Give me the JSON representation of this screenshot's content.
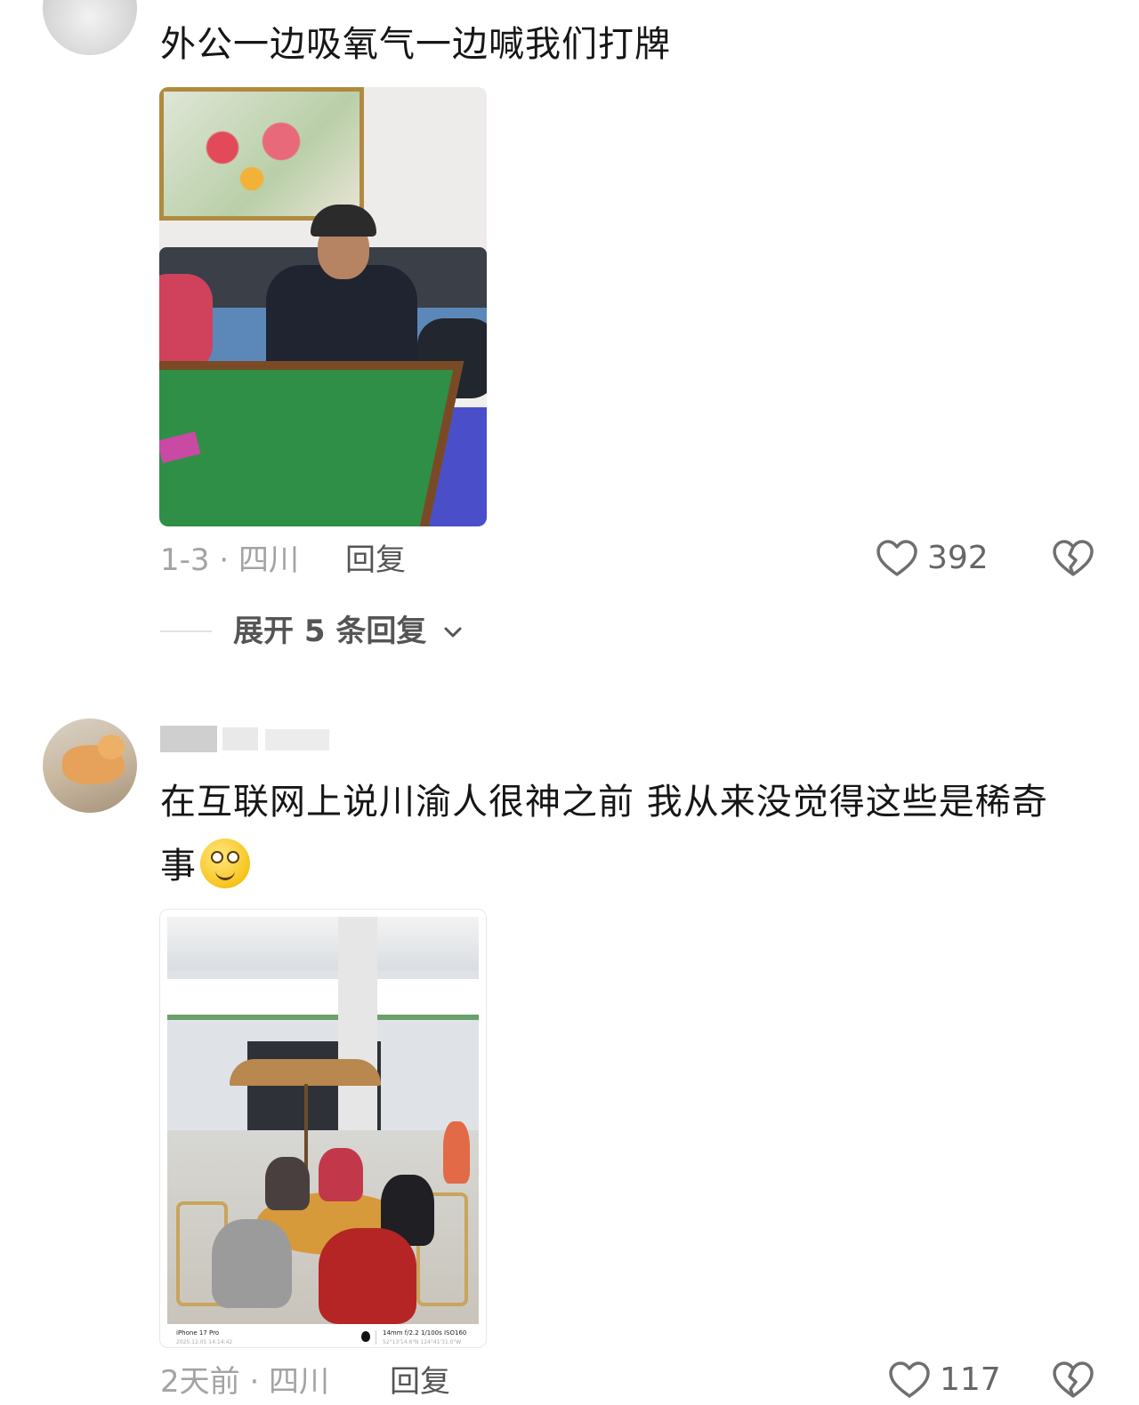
{
  "comments": [
    {
      "text": "外公一边吸氧气一边喊我们打牌",
      "meta": "1-3 · 四川",
      "reply_label": "回复",
      "likes": "392",
      "expand_label": "展开 5 条回复"
    },
    {
      "text": "在互联网上说川渝人很神之前 我从来没觉得这些是稀奇事",
      "meta": "2天前 · 四川",
      "reply_label": "回复",
      "likes": "117",
      "photo_caption": {
        "device": "iPhone 17 Pro",
        "datetime": "2025.12.05 14:14:42",
        "specs": "14mm f/2.2 1/100s ISO160",
        "location": "52°13'14.6\"N 124°41'31.0\"W"
      }
    }
  ],
  "icons": {
    "like": "heart-outline-icon",
    "dislike": "broken-heart-icon",
    "expand": "chevron-down-icon",
    "emoji": "smiley-emoji"
  },
  "colors": {
    "meta": "#a3a3a3",
    "action": "#555555",
    "text": "#161616"
  }
}
